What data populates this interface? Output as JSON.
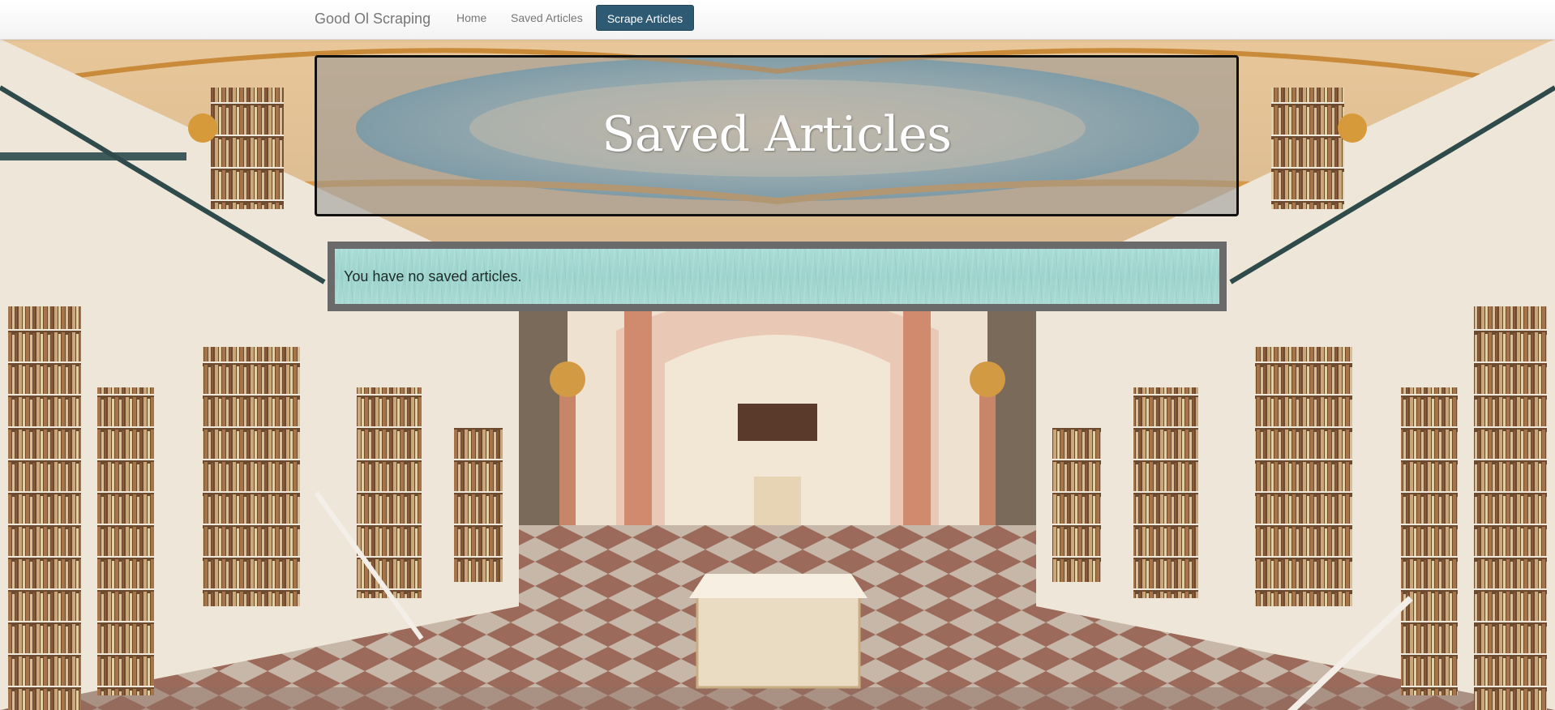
{
  "navbar": {
    "brand": "Good Ol Scraping",
    "links": [
      {
        "label": "Home"
      },
      {
        "label": "Saved Articles"
      }
    ],
    "scrape_button": "Scrape Articles"
  },
  "jumbotron": {
    "title": "Saved Articles"
  },
  "notice": {
    "text": "You have no saved articles."
  },
  "colors": {
    "scrape_button_bg": "#2f5a73",
    "notice_bg": "#a9dcd6",
    "notice_border": "#6a6a6a",
    "jumbotron_border": "#111111"
  }
}
